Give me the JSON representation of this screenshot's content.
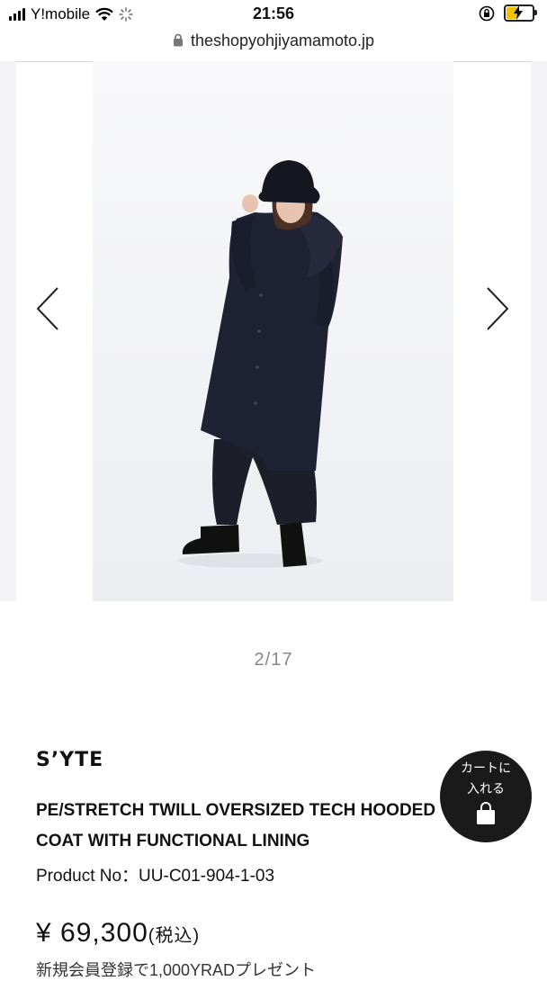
{
  "status_bar": {
    "carrier": "Y!mobile",
    "time": "21:56",
    "icons": [
      "signal-icon",
      "wifi-icon",
      "loading-icon",
      "orientation-lock-icon",
      "battery-charging-icon"
    ]
  },
  "browser": {
    "url": "theshopyohjiyamamoto.jp"
  },
  "gallery": {
    "counter": "2/17",
    "prev_icon": "chevron-left-icon",
    "next_icon": "chevron-right-icon",
    "image_subject": "model wearing black oversized hooded coat, bucket hat and wide trousers"
  },
  "product": {
    "brand": "S’YTE",
    "title_line1": "PE/STRETCH TWILL OVERSIZED TECH HOODED",
    "title_line2": "COAT WITH FUNCTIONAL LINING",
    "product_no": "Product No：UU-C01-904-1-03",
    "price": "¥ 69,300",
    "tax_note": "(税込)",
    "promo": "新規会員登録で1,000YRADプレゼント"
  },
  "cart": {
    "label_line1": "カートに",
    "label_line2": "入れる",
    "icon": "shopping-bag-icon"
  },
  "colors": {
    "cart_bg": "#1a1a1a",
    "counter_text": "#888888",
    "battery_fill": "#f2c200"
  }
}
